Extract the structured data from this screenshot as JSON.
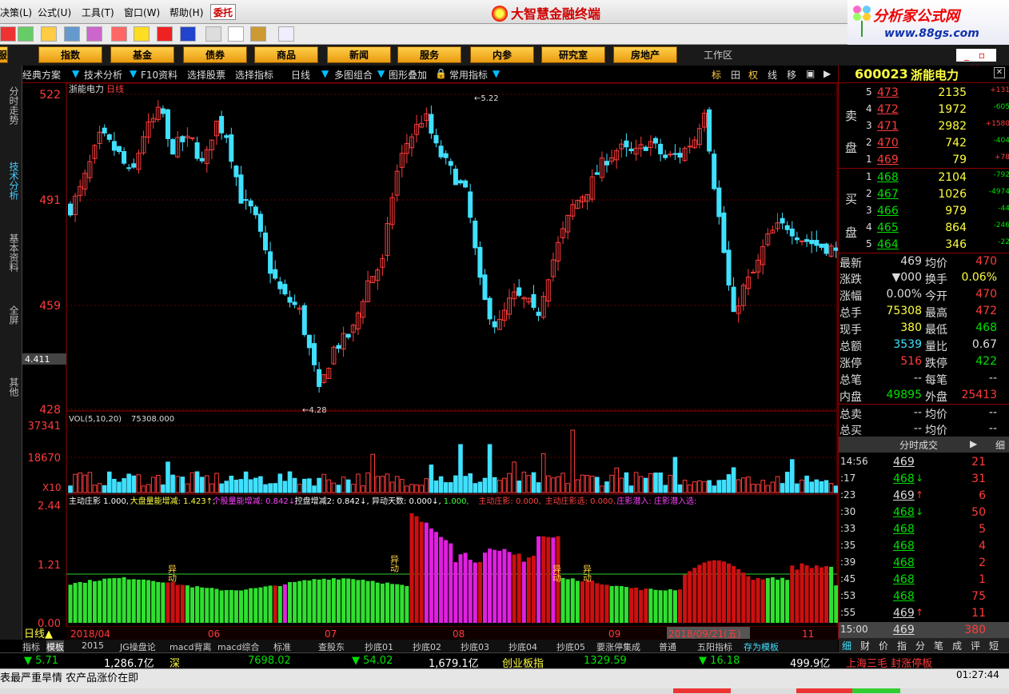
{
  "menu": [
    "决策(L)",
    "公式(U)",
    "工具(T)",
    "窗口(W)",
    "帮助(H)"
  ],
  "weituo": "委托",
  "app_title": "大智慧金融终端",
  "banner": {
    "line1": "分析家公式网",
    "line2": "www.88gs.com"
  },
  "categories": [
    "服",
    "指数",
    "基金",
    "债券",
    "商品",
    "新闻",
    "服务",
    "内参",
    "研究室",
    "房地产"
  ],
  "workspace": "工作区",
  "window_buttons": "_ ▫ ✕",
  "left_tabs": [
    "分时走势",
    "技术分析",
    "基本资料",
    "全屏",
    "其他"
  ],
  "chart_toolbar": {
    "items": [
      "经典方案",
      "技术分析",
      "F10资料",
      "选择股票",
      "选择指标",
      "日线",
      "多图组合",
      "图形叠加",
      "常用指标"
    ],
    "right": [
      "标",
      "田",
      "权",
      "线",
      "移"
    ]
  },
  "price_panel": {
    "stock_label": "浙能电力",
    "period": "日线",
    "y_ticks": [
      "522",
      "491",
      "459",
      "428"
    ],
    "left_readout": "4.411",
    "high_label": "5.22",
    "low_label": "4.28"
  },
  "vol_panel": {
    "legend": "VOL(5,10,20)",
    "value": "75308.000",
    "y_ticks": [
      "37341",
      "18670"
    ],
    "unit": "X10"
  },
  "ind_panel": {
    "legend": [
      {
        "text": "主动庄影 1.000,",
        "color": "#ffffff"
      },
      {
        "text": "大盘量能增减: 1.423↑,",
        "color": "#ffff40"
      },
      {
        "text": "个股量能增减: 0.842↓,",
        "color": "#ff40ff"
      },
      {
        "text": "控盘增减2: 0.842↓,",
        "color": "#ffffff"
      },
      {
        "text": "异动天数: 0.000↓,",
        "color": "#ffffff"
      },
      {
        "text": "1.000,",
        "color": "#40ff40"
      },
      {
        "text": "主动庄影: 0.000,",
        "color": "#ff4040"
      },
      {
        "text": "主动庄影选: 0.000,",
        "color": "#ff4040"
      },
      {
        "text": "庄影潜入: 庄影潜入选:",
        "color": "#ff40ff"
      }
    ],
    "y_ticks": [
      "2.44",
      "1.21",
      "0.00"
    ],
    "marker": "异动"
  },
  "x_axis": {
    "labels": [
      "2018/04",
      "06",
      "07",
      "08",
      "09",
      "2018/09/21(五)",
      "11"
    ],
    "bottom_label": "日线"
  },
  "indicator_tabs": [
    "指标",
    "模板",
    "2015",
    "JG操盘论",
    "macd背离",
    "macd综合",
    "标准",
    "查股东",
    "抄底01",
    "抄底02",
    "抄底03",
    "抄底04",
    "抄底05",
    "要涨停集成",
    "普通",
    "五阳指标",
    "存为模板"
  ],
  "quote": {
    "code": "600023",
    "name": "浙能电力",
    "sell": [
      {
        "lvl": "5",
        "price": "473",
        "vol": "2135",
        "chg": "+131"
      },
      {
        "lvl": "4",
        "price": "472",
        "vol": "1972",
        "chg": "-605"
      },
      {
        "lvl": "3",
        "price": "471",
        "vol": "2982",
        "chg": "+1580"
      },
      {
        "lvl": "2",
        "price": "470",
        "vol": "742",
        "chg": "-404"
      },
      {
        "lvl": "1",
        "price": "469",
        "vol": "79",
        "chg": "+78"
      }
    ],
    "buy": [
      {
        "lvl": "1",
        "price": "468",
        "vol": "2104",
        "chg": "-792"
      },
      {
        "lvl": "2",
        "price": "467",
        "vol": "1026",
        "chg": "-4974"
      },
      {
        "lvl": "3",
        "price": "466",
        "vol": "979",
        "chg": "-44"
      },
      {
        "lvl": "4",
        "price": "465",
        "vol": "864",
        "chg": "-246"
      },
      {
        "lvl": "5",
        "price": "464",
        "vol": "346",
        "chg": "-22"
      }
    ],
    "sell_label": [
      "卖",
      "盘"
    ],
    "buy_label": [
      "买",
      "盘"
    ],
    "stats": [
      [
        "最新",
        "469",
        "均价",
        "470"
      ],
      [
        "涨跌",
        "▼000",
        "换手",
        "0.06%"
      ],
      [
        "涨幅",
        "0.00%",
        "今开",
        "470"
      ],
      [
        "总手",
        "75308",
        "最高",
        "472"
      ],
      [
        "现手",
        "380",
        "最低",
        "468"
      ],
      [
        "总额",
        "3539",
        "量比",
        "0.67"
      ],
      [
        "涨停",
        "516",
        "跌停",
        "422"
      ],
      [
        "总笔",
        "--",
        "每笔",
        "--"
      ],
      [
        "内盘",
        "49895",
        "外盘",
        "25413"
      ],
      [
        "总卖",
        "--",
        "均价",
        "--"
      ],
      [
        "总买",
        "--",
        "均价",
        "--"
      ]
    ],
    "ticks_header": "分时成交",
    "ticks_btn": "细",
    "ticks": [
      [
        "14:56",
        "469",
        "21",
        ""
      ],
      [
        ":17",
        "468",
        "31",
        "↓"
      ],
      [
        ":23",
        "469",
        "6",
        "↑"
      ],
      [
        ":30",
        "468",
        "50",
        "↓"
      ],
      [
        ":33",
        "468",
        "5",
        ""
      ],
      [
        ":35",
        "468",
        "4",
        ""
      ],
      [
        ":39",
        "468",
        "2",
        ""
      ],
      [
        ":45",
        "468",
        "1",
        ""
      ],
      [
        ":53",
        "468",
        "75",
        ""
      ],
      [
        ":55",
        "469",
        "11",
        "↑"
      ],
      [
        "15:00",
        "469",
        "380",
        ""
      ]
    ],
    "bottom_tabs": [
      "细",
      "财",
      "价",
      "指",
      "分",
      "笔",
      "成",
      "评",
      "短"
    ]
  },
  "ticker": [
    {
      "t": "▼ 5.71",
      "c": "#00e000"
    },
    {
      "t": "1,286.7亿",
      "c": "#ffffff"
    },
    {
      "t": "深",
      "c": "#ffff40"
    },
    {
      "t": "7698.02",
      "c": "#00e000"
    },
    {
      "t": "▼ 54.02",
      "c": "#00e000"
    },
    {
      "t": "1,679.1亿",
      "c": "#ffffff"
    },
    {
      "t": "创业板指",
      "c": "#ffff40"
    },
    {
      "t": "1329.59",
      "c": "#00e000"
    },
    {
      "t": "▼ 16.18",
      "c": "#00e000"
    },
    {
      "t": "499.9亿",
      "c": "#ffffff"
    },
    {
      "t": "上海三毛 封涨停板",
      "c": "#ff3b3b"
    }
  ],
  "news": "表最严重旱情 农产品涨价在即",
  "clock": "01:27:44"
}
